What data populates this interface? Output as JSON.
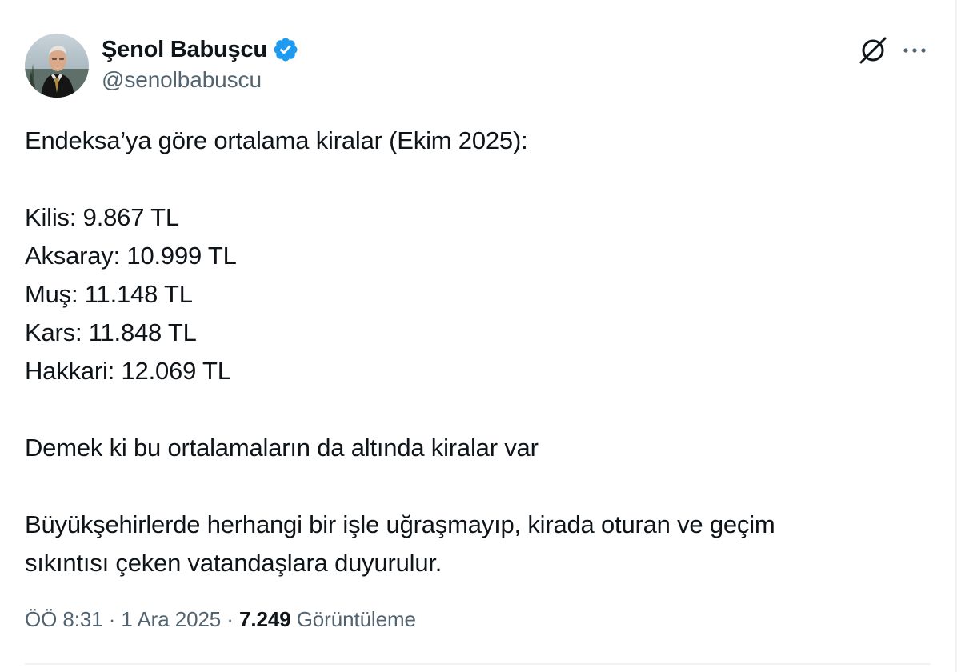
{
  "author": {
    "display_name": "Şenol Babuşcu",
    "handle": "@senolbabuscu",
    "verified": true,
    "verified_color": "#1d9bf0",
    "avatar_icon": "profile-photo"
  },
  "header_actions": {
    "grok_icon": "grok-icon",
    "more_icon": "more-icon"
  },
  "tweet": {
    "intro": "Endeksa’ya göre ortalama kiralar (Ekim 2025):",
    "rents": [
      "Kilis: 9.867 TL",
      "Aksaray: 10.999 TL",
      "Muş: 11.148 TL",
      "Kars: 11.848 TL",
      "Hakkari: 12.069 TL"
    ],
    "note": "Demek ki bu ortalamaların da altında kiralar var",
    "closing_line_1": "Büyükşehirlerde herhangi bir işle uğraşmayıp, kirada oturan ve geçim",
    "closing_line_2": "sıkıntısı çeken vatandaşlara duyurulur."
  },
  "meta": {
    "time": "ÖÖ 8:31",
    "separator": "·",
    "date": "1 Ara 2025",
    "views_count": "7.249",
    "views_label": "Görüntüleme"
  }
}
